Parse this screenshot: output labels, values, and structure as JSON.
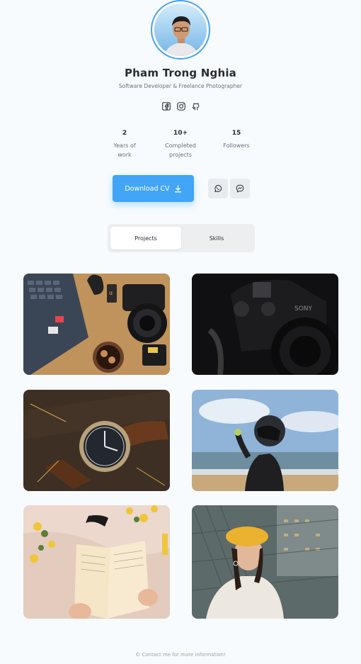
{
  "profile": {
    "name": "Pham Trong Nghia",
    "tagline": "Software Developer & Freelance Photographer",
    "avatar_icon": "person-portrait"
  },
  "socials": [
    {
      "icon": "facebook-icon"
    },
    {
      "icon": "instagram-icon"
    },
    {
      "icon": "github-icon"
    }
  ],
  "stats": [
    {
      "value": "2",
      "label_line1": "Years of",
      "label_line2": "work"
    },
    {
      "value": "10+",
      "label_line1": "Completed",
      "label_line2": "projects"
    },
    {
      "value": "15",
      "label_line1": "Followers",
      "label_line2": ""
    }
  ],
  "actions": {
    "download_label": "Download CV",
    "download_icon": "download-icon",
    "whatsapp_icon": "whatsapp-icon",
    "messenger_icon": "messenger-icon"
  },
  "tabs": [
    {
      "label": "Projects",
      "active": true
    },
    {
      "label": "Skills",
      "active": false
    }
  ],
  "gallery": [
    {
      "subject": "laptop-and-camera-flatlay"
    },
    {
      "subject": "dark-sony-camera"
    },
    {
      "subject": "wristwatch"
    },
    {
      "subject": "helmet-rider-beach"
    },
    {
      "subject": "open-book-flowers"
    },
    {
      "subject": "woman-yellow-beret"
    }
  ],
  "footer": {
    "text": "© Contact me for more information!"
  },
  "colors": {
    "accent": "#42a5f5",
    "background": "#f7fbfe",
    "text": "#2b2b33",
    "muted": "#6b6f7a"
  }
}
